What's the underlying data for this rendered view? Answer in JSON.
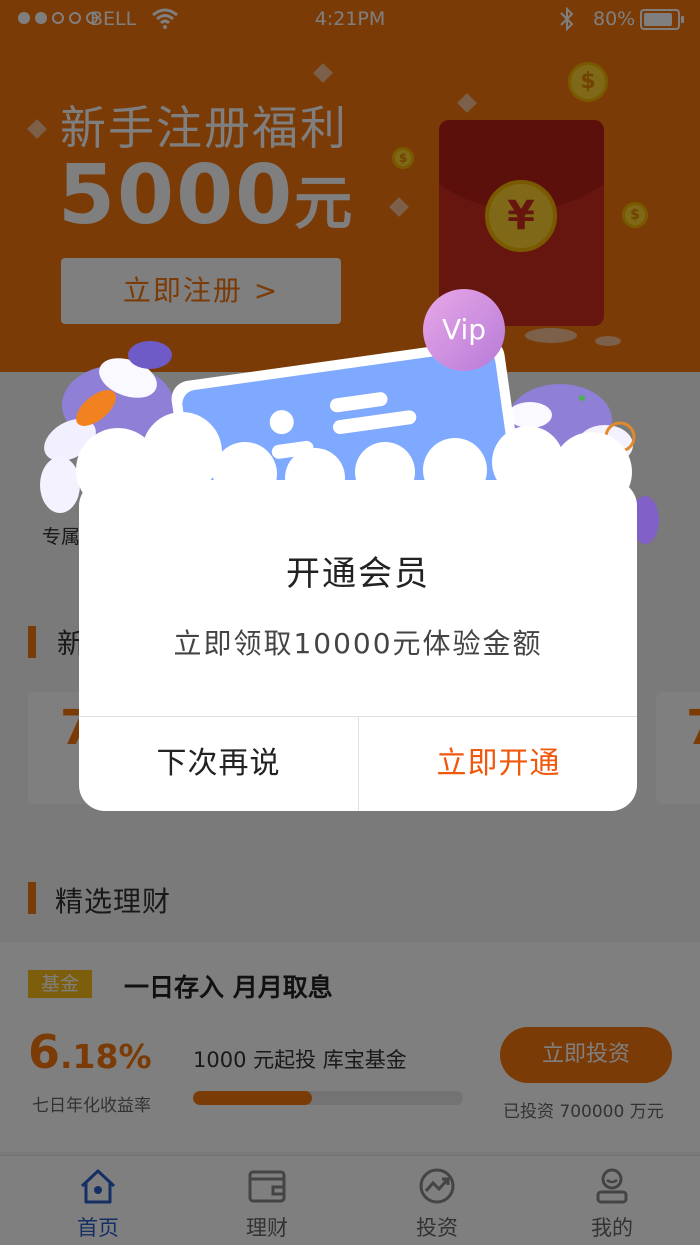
{
  "status_bar": {
    "carrier": "BELL",
    "time": "4:21PM",
    "battery": "80%",
    "battery_level": 0.8
  },
  "banner": {
    "title": "新手注册福利",
    "amount": "5000",
    "amount_unit": "元",
    "register_label": "立即注册 >"
  },
  "background": {
    "feature_caption_fragment": "专属",
    "new_section_fragment": "新",
    "card_number_fragment": "7",
    "section_title": "精选理财",
    "product": {
      "tag": "基金",
      "title": "一日存入   月月取息",
      "rate_int": "6",
      "rate_dec": ".18%",
      "rate_label": "七日年化收益率",
      "invest_info": "1000 元起投   库宝基金",
      "progress": 0.44,
      "invest_button": "立即投资",
      "invested_text": "已投资 700000 万元"
    }
  },
  "tabs": [
    {
      "label": "首页",
      "icon": "home-icon",
      "active": true
    },
    {
      "label": "理财",
      "icon": "wallet-icon",
      "active": false
    },
    {
      "label": "投资",
      "icon": "chart-icon",
      "active": false
    },
    {
      "label": "我的",
      "icon": "user-icon",
      "active": false
    }
  ],
  "modal": {
    "badge": "Vip",
    "title": "开通会员",
    "message": "立即领取10000元体验金额",
    "cancel_label": "下次再说",
    "confirm_label": "立即开通"
  },
  "colors": {
    "brand_orange": "#f6760f",
    "confirm_text": "#f0580e",
    "card_blue": "#7fa8ff",
    "vip_badge": "#c88ee0",
    "active_tab": "#2b5fc9"
  }
}
